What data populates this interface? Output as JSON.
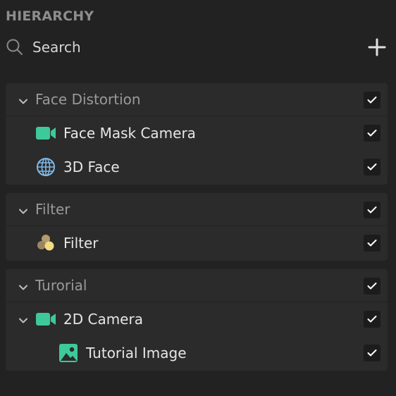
{
  "panel": {
    "title": "HIERARCHY"
  },
  "search": {
    "placeholder": "Search"
  },
  "groups": [
    {
      "name": "Face Distortion",
      "expanded": true,
      "checked": true,
      "items": [
        {
          "label": "Face Mask Camera",
          "icon": "camera-icon",
          "checked": true
        },
        {
          "label": "3D Face",
          "icon": "globe-mesh-icon",
          "checked": true
        }
      ]
    },
    {
      "name": "Filter",
      "expanded": true,
      "checked": true,
      "items": [
        {
          "label": "Filter",
          "icon": "filter-icon",
          "checked": true
        }
      ]
    },
    {
      "name": "Turorial",
      "expanded": true,
      "checked": true,
      "items": [
        {
          "label": "2D Camera",
          "icon": "camera-icon",
          "checked": true,
          "expanded": true
        },
        {
          "label": "Tutorial Image",
          "icon": "image-icon",
          "checked": true
        }
      ]
    }
  ],
  "colors": {
    "background": "#222222",
    "group_background": "#2b2b2b",
    "accent_green": "#3ec99a",
    "globe_blue": "#7fb8e6"
  }
}
